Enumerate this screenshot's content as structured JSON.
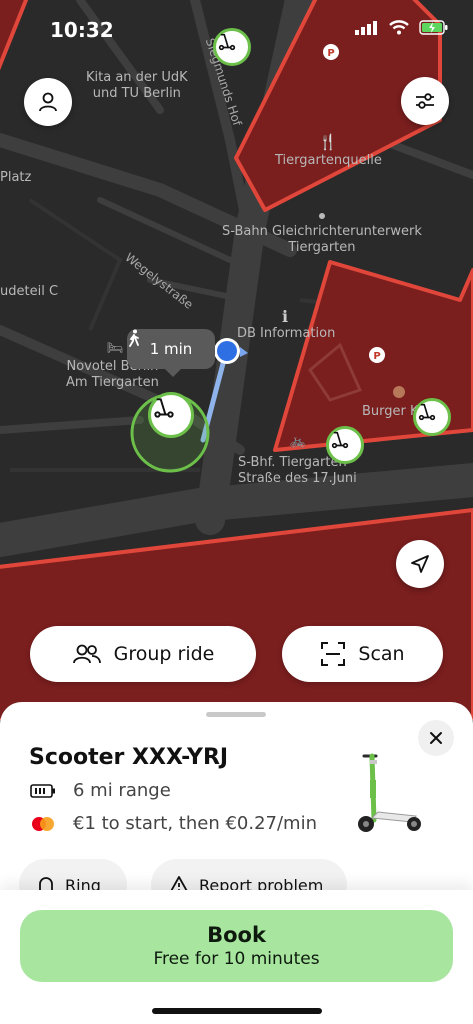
{
  "status": {
    "time": "10:32"
  },
  "map": {
    "labels": {
      "kita": "Kita an der UdK\nund TU Berlin",
      "tiergartenquelle": "Tiergartenquelle",
      "sbahn_werk": "S-Bahn Gleichrichterunterwerk\nTiergarten",
      "platz": "Platz",
      "udeteil": "udeteil C",
      "db_info": "DB Information",
      "novotel": "Novotel Berlin\nAm Tiergarten",
      "burger": "Burger K",
      "sbhf": "S-Bhf. Tiergarten\nStraße des 17.Juni",
      "siegmunds": "Siegmunds Hof",
      "wegely": "Wegelystraße"
    },
    "walk_time": "1 min"
  },
  "actions": {
    "group_ride": "Group ride",
    "scan": "Scan"
  },
  "vehicle": {
    "title": "Scooter XXX-YRJ",
    "range": "6 mi range",
    "pricing": "€1 to start, then €0.27/min",
    "ring_label": "Ring",
    "report_label": "Report problem"
  },
  "booking": {
    "title": "Book",
    "subtitle": "Free for 10 minutes"
  },
  "colors": {
    "zone_fill": "#7a1e1e",
    "zone_stroke": "#e0463a",
    "pin_ring": "#6cc04a",
    "book_button": "#a8e6a0",
    "location_dot": "#2f6fe4"
  }
}
